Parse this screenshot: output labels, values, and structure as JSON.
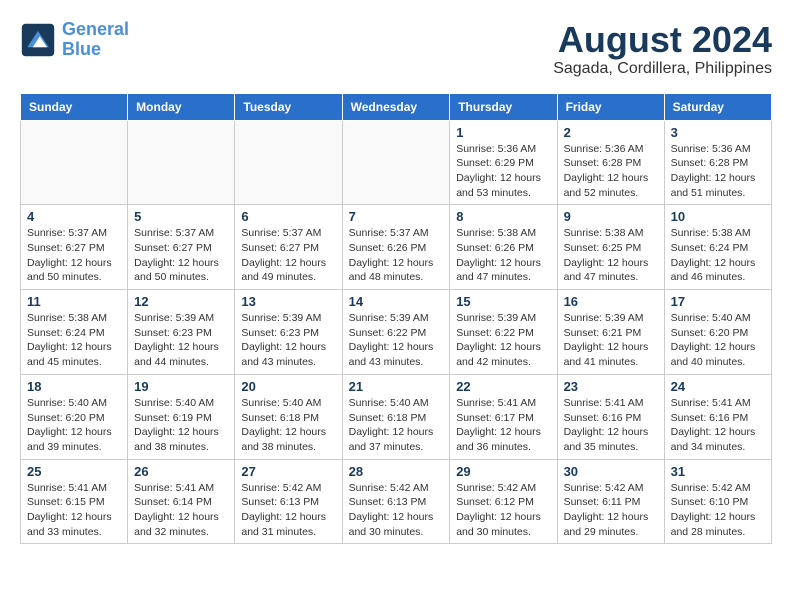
{
  "header": {
    "logo_line1": "General",
    "logo_line2": "Blue",
    "month_year": "August 2024",
    "location": "Sagada, Cordillera, Philippines"
  },
  "weekdays": [
    "Sunday",
    "Monday",
    "Tuesday",
    "Wednesday",
    "Thursday",
    "Friday",
    "Saturday"
  ],
  "weeks": [
    [
      {
        "day": "",
        "info": ""
      },
      {
        "day": "",
        "info": ""
      },
      {
        "day": "",
        "info": ""
      },
      {
        "day": "",
        "info": ""
      },
      {
        "day": "1",
        "info": "Sunrise: 5:36 AM\nSunset: 6:29 PM\nDaylight: 12 hours\nand 53 minutes."
      },
      {
        "day": "2",
        "info": "Sunrise: 5:36 AM\nSunset: 6:28 PM\nDaylight: 12 hours\nand 52 minutes."
      },
      {
        "day": "3",
        "info": "Sunrise: 5:36 AM\nSunset: 6:28 PM\nDaylight: 12 hours\nand 51 minutes."
      }
    ],
    [
      {
        "day": "4",
        "info": "Sunrise: 5:37 AM\nSunset: 6:27 PM\nDaylight: 12 hours\nand 50 minutes."
      },
      {
        "day": "5",
        "info": "Sunrise: 5:37 AM\nSunset: 6:27 PM\nDaylight: 12 hours\nand 50 minutes."
      },
      {
        "day": "6",
        "info": "Sunrise: 5:37 AM\nSunset: 6:27 PM\nDaylight: 12 hours\nand 49 minutes."
      },
      {
        "day": "7",
        "info": "Sunrise: 5:37 AM\nSunset: 6:26 PM\nDaylight: 12 hours\nand 48 minutes."
      },
      {
        "day": "8",
        "info": "Sunrise: 5:38 AM\nSunset: 6:26 PM\nDaylight: 12 hours\nand 47 minutes."
      },
      {
        "day": "9",
        "info": "Sunrise: 5:38 AM\nSunset: 6:25 PM\nDaylight: 12 hours\nand 47 minutes."
      },
      {
        "day": "10",
        "info": "Sunrise: 5:38 AM\nSunset: 6:24 PM\nDaylight: 12 hours\nand 46 minutes."
      }
    ],
    [
      {
        "day": "11",
        "info": "Sunrise: 5:38 AM\nSunset: 6:24 PM\nDaylight: 12 hours\nand 45 minutes."
      },
      {
        "day": "12",
        "info": "Sunrise: 5:39 AM\nSunset: 6:23 PM\nDaylight: 12 hours\nand 44 minutes."
      },
      {
        "day": "13",
        "info": "Sunrise: 5:39 AM\nSunset: 6:23 PM\nDaylight: 12 hours\nand 43 minutes."
      },
      {
        "day": "14",
        "info": "Sunrise: 5:39 AM\nSunset: 6:22 PM\nDaylight: 12 hours\nand 43 minutes."
      },
      {
        "day": "15",
        "info": "Sunrise: 5:39 AM\nSunset: 6:22 PM\nDaylight: 12 hours\nand 42 minutes."
      },
      {
        "day": "16",
        "info": "Sunrise: 5:39 AM\nSunset: 6:21 PM\nDaylight: 12 hours\nand 41 minutes."
      },
      {
        "day": "17",
        "info": "Sunrise: 5:40 AM\nSunset: 6:20 PM\nDaylight: 12 hours\nand 40 minutes."
      }
    ],
    [
      {
        "day": "18",
        "info": "Sunrise: 5:40 AM\nSunset: 6:20 PM\nDaylight: 12 hours\nand 39 minutes."
      },
      {
        "day": "19",
        "info": "Sunrise: 5:40 AM\nSunset: 6:19 PM\nDaylight: 12 hours\nand 38 minutes."
      },
      {
        "day": "20",
        "info": "Sunrise: 5:40 AM\nSunset: 6:18 PM\nDaylight: 12 hours\nand 38 minutes."
      },
      {
        "day": "21",
        "info": "Sunrise: 5:40 AM\nSunset: 6:18 PM\nDaylight: 12 hours\nand 37 minutes."
      },
      {
        "day": "22",
        "info": "Sunrise: 5:41 AM\nSunset: 6:17 PM\nDaylight: 12 hours\nand 36 minutes."
      },
      {
        "day": "23",
        "info": "Sunrise: 5:41 AM\nSunset: 6:16 PM\nDaylight: 12 hours\nand 35 minutes."
      },
      {
        "day": "24",
        "info": "Sunrise: 5:41 AM\nSunset: 6:16 PM\nDaylight: 12 hours\nand 34 minutes."
      }
    ],
    [
      {
        "day": "25",
        "info": "Sunrise: 5:41 AM\nSunset: 6:15 PM\nDaylight: 12 hours\nand 33 minutes."
      },
      {
        "day": "26",
        "info": "Sunrise: 5:41 AM\nSunset: 6:14 PM\nDaylight: 12 hours\nand 32 minutes."
      },
      {
        "day": "27",
        "info": "Sunrise: 5:42 AM\nSunset: 6:13 PM\nDaylight: 12 hours\nand 31 minutes."
      },
      {
        "day": "28",
        "info": "Sunrise: 5:42 AM\nSunset: 6:13 PM\nDaylight: 12 hours\nand 30 minutes."
      },
      {
        "day": "29",
        "info": "Sunrise: 5:42 AM\nSunset: 6:12 PM\nDaylight: 12 hours\nand 30 minutes."
      },
      {
        "day": "30",
        "info": "Sunrise: 5:42 AM\nSunset: 6:11 PM\nDaylight: 12 hours\nand 29 minutes."
      },
      {
        "day": "31",
        "info": "Sunrise: 5:42 AM\nSunset: 6:10 PM\nDaylight: 12 hours\nand 28 minutes."
      }
    ]
  ]
}
